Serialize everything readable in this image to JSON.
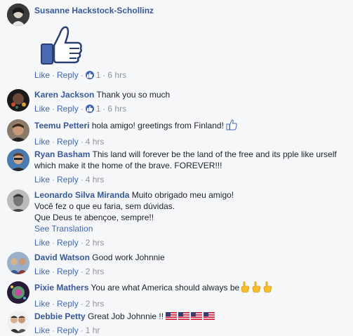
{
  "actions": {
    "like": "Like",
    "reply": "Reply",
    "dot": "·"
  },
  "comments": [
    {
      "author": "Susanne Hackstock-Schollinz",
      "text": "",
      "reactions": "1",
      "time": "6 hrs",
      "sticker": "thumbs-up-sticker"
    },
    {
      "author": "Karen Jackson",
      "text": "Thank you so much",
      "reactions": "1",
      "time": "6 hrs"
    },
    {
      "author": "Teemu Petteri",
      "text": "hola amigo! greetings from Finland!",
      "time": "4 hrs"
    },
    {
      "author": "Ryan Basham",
      "text": "This land will forever be the land of the free and its pple like urself which make it the home of the brave. FOREVER!!!",
      "time": "4 hrs"
    },
    {
      "author": "Leonardo Silva Miranda",
      "text_lines": [
        "Muito obrigado meu amigo!",
        "Você fez o que eu faria, sem dúvidas.",
        "Que Deus te abençoe, sempre!!"
      ],
      "see_translation": "See Translation",
      "time": "2 hrs"
    },
    {
      "author": "David Watson",
      "text": "Good work Johnnie",
      "time": "2 hrs"
    },
    {
      "author": "Pixie Mathers",
      "text": "You are what America should always be",
      "time": "2 hrs"
    },
    {
      "author": "Debbie Petty",
      "text": "Great Job Johnnie !!",
      "time": "1 hr"
    }
  ],
  "colors": {
    "link": "#385898",
    "action": "#4267b2",
    "meta": "#90949c",
    "background": "#f6f7f9"
  }
}
